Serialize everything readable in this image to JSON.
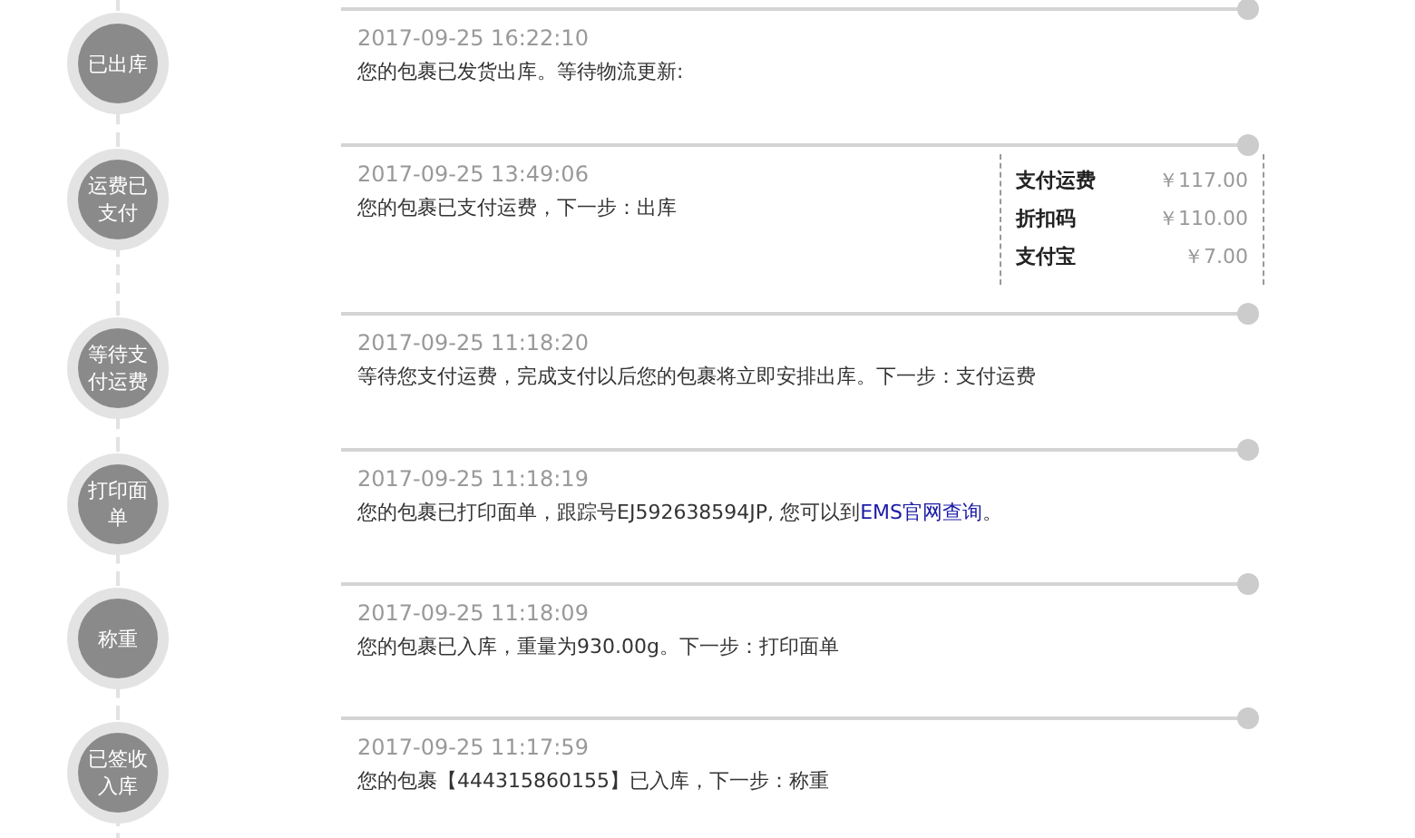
{
  "timeline": [
    {
      "status": "已出库",
      "time": "2017-09-25 16:22:10",
      "description": "您的包裹已发货出库。等待物流更新:"
    },
    {
      "status": "运费已支付",
      "time": "2017-09-25 13:49:06",
      "description": "您的包裹已支付运费，下一步：出库",
      "costs": [
        {
          "label": "支付运费",
          "amount": "￥117.00"
        },
        {
          "label": "折扣码",
          "amount": "￥110.00"
        },
        {
          "label": "支付宝",
          "amount": "￥7.00"
        }
      ]
    },
    {
      "status": "等待支付运费",
      "time": "2017-09-25 11:18:20",
      "description": "等待您支付运费，完成支付以后您的包裹将立即安排出库。下一步：支付运费"
    },
    {
      "status": "打印面单",
      "time": "2017-09-25 11:18:19",
      "description": "您的包裹已打印面单，跟踪号EJ592638594JP, 您可以到",
      "link": "EMS官网查询",
      "after_link": "。"
    },
    {
      "status": "称重",
      "time": "2017-09-25 11:18:09",
      "description": "您的包裹已入库，重量为930.00g。下一步：打印面单"
    },
    {
      "status": "已签收入库",
      "time": "2017-09-25 11:17:59",
      "description": "您的包裹【444315860155】已入库，下一步：称重"
    }
  ]
}
